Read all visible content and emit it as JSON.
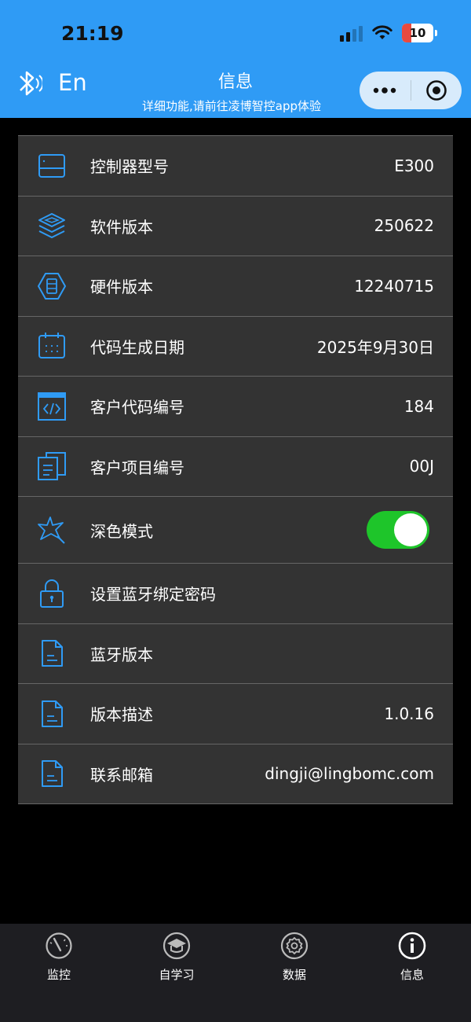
{
  "status": {
    "time": "21:19",
    "battery": "10"
  },
  "header": {
    "lang_label": "En",
    "title": "信息",
    "subtitle": "详细功能,请前往凌博智控app体验"
  },
  "colors": {
    "brand_blue": "#2f9bf5",
    "icon_blue": "#2f9bf5",
    "toggle_on": "#1ec52a",
    "row_bg": "#333333"
  },
  "info_list": [
    {
      "icon": "controller-icon",
      "label": "控制器型号",
      "value": "E300"
    },
    {
      "icon": "layers-icon",
      "label": "软件版本",
      "value": "250622"
    },
    {
      "icon": "hardware-icon",
      "label": "硬件版本",
      "value": "12240715"
    },
    {
      "icon": "calendar-icon",
      "label": "代码生成日期",
      "value": "2025年9月30日"
    },
    {
      "icon": "code-icon",
      "label": "客户代码编号",
      "value": "184"
    },
    {
      "icon": "documents-icon",
      "label": "客户项目编号",
      "value": "00J"
    },
    {
      "icon": "star-icon",
      "label": "深色模式",
      "toggle": true
    },
    {
      "icon": "lock-icon",
      "label": "设置蓝牙绑定密码",
      "value": ""
    },
    {
      "icon": "file-icon",
      "label": "蓝牙版本",
      "value": ""
    },
    {
      "icon": "file-icon",
      "label": "版本描述",
      "value": "1.0.16"
    },
    {
      "icon": "file-icon",
      "label": "联系邮箱",
      "value": "dingji@lingbomc.com"
    }
  ],
  "tabs": [
    {
      "icon": "gauge-icon",
      "label": "监控"
    },
    {
      "icon": "graduation-cap-icon",
      "label": "自学习"
    },
    {
      "icon": "gear-icon",
      "label": "数据"
    },
    {
      "icon": "info-icon",
      "label": "信息",
      "active": true
    }
  ]
}
